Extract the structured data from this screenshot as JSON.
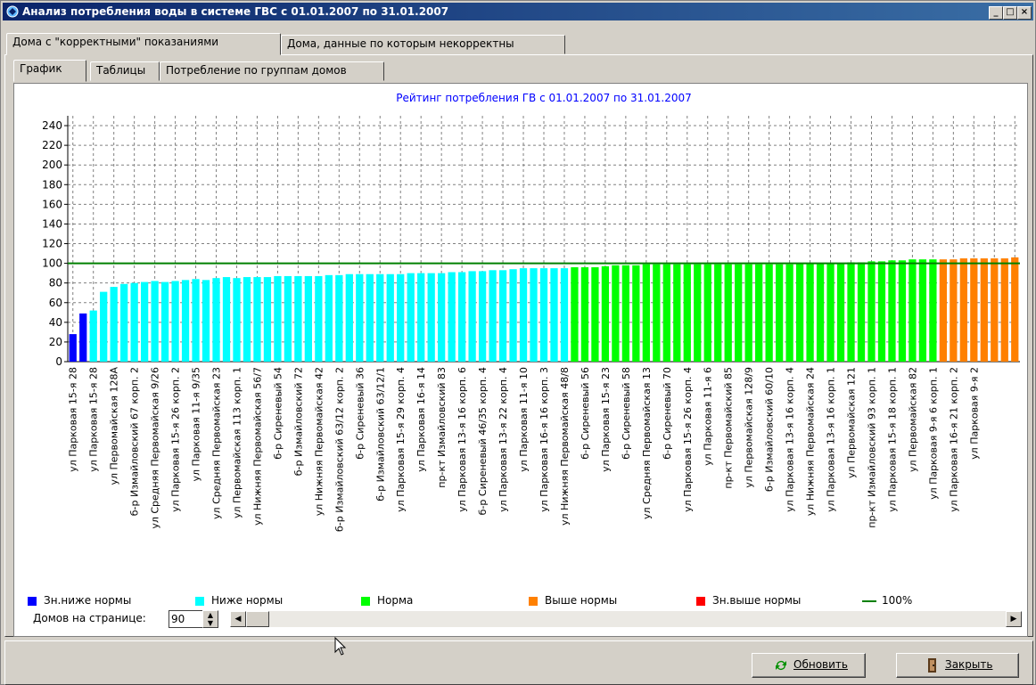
{
  "window": {
    "title": "Анализ потребления воды в системе ГВС с 01.01.2007 по 31.01.2007"
  },
  "top_tabs": [
    "Дома с \"корректными\" показаниями",
    "Дома, данные по которым некорректны"
  ],
  "sub_tabs": [
    "График",
    "Таблицы",
    "Потребление по группам домов"
  ],
  "legend": [
    {
      "label": "Зн.ниже нормы",
      "color": "#0000ff"
    },
    {
      "label": "Ниже нормы",
      "color": "#00ffff"
    },
    {
      "label": "Норма",
      "color": "#00ff00"
    },
    {
      "label": "Выше нормы",
      "color": "#ff8000"
    },
    {
      "label": "Зн.выше нормы",
      "color": "#ff0000"
    },
    {
      "label": "100%",
      "color": "#008000"
    }
  ],
  "controls": {
    "page_size_label": "Домов на странице:",
    "page_size_value": "90"
  },
  "buttons": {
    "refresh": "Обновить",
    "close": "Закрыть"
  },
  "chart_data": {
    "type": "bar",
    "title": "Рейтинг потребления ГВ с 01.01.2007 по 31.01.2007",
    "ylim": [
      0,
      250
    ],
    "yticks": [
      0,
      20,
      40,
      60,
      80,
      100,
      120,
      140,
      160,
      180,
      200,
      220,
      240
    ],
    "reference_line": 100,
    "grid": true,
    "category_labels": [
      "ул Парковая 15-я 28",
      "ул Парковая 15-я 28",
      "ул Первомайская 128А",
      "б-р Измайловский 67 корп. 2",
      "ул Средняя Первомайская 9/26",
      "ул Парковая 15-я 26 корп. 2",
      "ул Парковая 11-я 9/35",
      "ул Средняя Первомайская 23",
      "ул Первомайская 113 корп. 1",
      "ул Нижняя Первомайская 56/7",
      "б-р Сиреневый 54",
      "б-р Измайловский 72",
      "ул Нижняя Первомайская 42",
      "б-р Измайловский 63/12 корп. 2",
      "б-р Сиреневый 36",
      "б-р Измайловский 63/12/1",
      "ул Парковая 15-я 29 корп. 4",
      "ул Парковая 16-я 14",
      "пр-кт Измайловский 83",
      "ул Парковая 13-я 16 корп. 6",
      "б-р Сиреневый 46/35 корп. 4",
      "ул Парковая 13-я 22 корп. 4",
      "ул Парковая 11-я 10",
      "ул Парковая 16-я 16 корп. 3",
      "ул Нижняя Первомайская 48/8",
      "б-р Сиреневый 56",
      "ул Парковая 15-я 23",
      "б-р Сиреневый 58",
      "ул Средняя Первомайская 13",
      "б-р Сиреневый 70",
      "ул Парковая 15-я 26 корп. 4",
      "ул Парковая 11-я 6",
      "пр-кт Первомайский 85",
      "ул Первомайская 128/9",
      "б-р Измайловский 60/10",
      "ул Парковая 13-я 16 корп. 4",
      "ул Нижняя Первомайская 24",
      "ул Парковая 13-я 16 корп. 1",
      "ул Первомайская 121",
      "пр-кт Измайловский 93 корп. 1",
      "ул Парковая 15-я 18 корп. 1",
      "ул Первомайская 82",
      "ул Парковая 9-я 6 корп. 1",
      "ул Парковая 16-я 21 корп. 2",
      "ул Парковая 9-я 2"
    ],
    "values": [
      28,
      49,
      52,
      71,
      76,
      79,
      80,
      81,
      82,
      81,
      82,
      83,
      84,
      83,
      85,
      86,
      85,
      86,
      86,
      86,
      87,
      87,
      87,
      87,
      87,
      88,
      88,
      89,
      89,
      89,
      89,
      89,
      89,
      90,
      90,
      90,
      90,
      91,
      91,
      92,
      92,
      93,
      93,
      94,
      95,
      95,
      95,
      95,
      95,
      96,
      96,
      96,
      97,
      98,
      98,
      98,
      99,
      99,
      99,
      99,
      99,
      99,
      99,
      99,
      99,
      99,
      99,
      99,
      99,
      99,
      99,
      100,
      100,
      100,
      100,
      100,
      101,
      101,
      102,
      102,
      103,
      103,
      104,
      104,
      104,
      104,
      104,
      105,
      105,
      105,
      105,
      105,
      106
    ],
    "series_colors": [
      "#0000ff",
      "#0000ff",
      "#00ffff",
      "#00ffff",
      "#00ffff",
      "#00ffff",
      "#00ffff",
      "#00ffff",
      "#00ffff",
      "#00ffff",
      "#00ffff",
      "#00ffff",
      "#00ffff",
      "#00ffff",
      "#00ffff",
      "#00ffff",
      "#00ffff",
      "#00ffff",
      "#00ffff",
      "#00ffff",
      "#00ffff",
      "#00ffff",
      "#00ffff",
      "#00ffff",
      "#00ffff",
      "#00ffff",
      "#00ffff",
      "#00ffff",
      "#00ffff",
      "#00ffff",
      "#00ffff",
      "#00ffff",
      "#00ffff",
      "#00ffff",
      "#00ffff",
      "#00ffff",
      "#00ffff",
      "#00ffff",
      "#00ffff",
      "#00ffff",
      "#00ffff",
      "#00ffff",
      "#00ffff",
      "#00ffff",
      "#00ffff",
      "#00ffff",
      "#00ffff",
      "#00ffff",
      "#00ffff",
      "#00ff00",
      "#00ff00",
      "#00ff00",
      "#00ff00",
      "#00ff00",
      "#00ff00",
      "#00ff00",
      "#00ff00",
      "#00ff00",
      "#00ff00",
      "#00ff00",
      "#00ff00",
      "#00ff00",
      "#00ff00",
      "#00ff00",
      "#00ff00",
      "#00ff00",
      "#00ff00",
      "#00ff00",
      "#00ff00",
      "#00ff00",
      "#00ff00",
      "#00ff00",
      "#00ff00",
      "#00ff00",
      "#00ff00",
      "#00ff00",
      "#00ff00",
      "#00ff00",
      "#00ff00",
      "#00ff00",
      "#00ff00",
      "#00ff00",
      "#00ff00",
      "#00ff00",
      "#00ff00",
      "#ff8000",
      "#ff8000",
      "#ff8000",
      "#ff8000",
      "#ff8000",
      "#ff8000",
      "#ff8000",
      "#ff8000"
    ]
  }
}
